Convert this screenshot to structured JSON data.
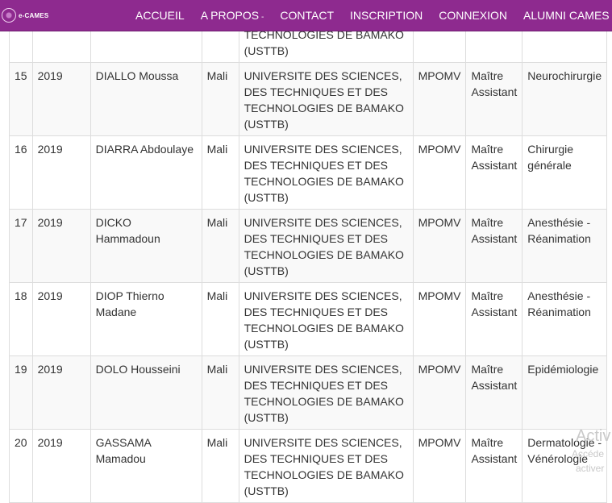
{
  "brand": {
    "logo_text": "e-CAMES"
  },
  "nav": {
    "items": [
      {
        "label": "ACCUEIL"
      },
      {
        "label": "A PROPOS",
        "caret": "-"
      },
      {
        "label": "CONTACT"
      },
      {
        "label": "INSCRIPTION"
      },
      {
        "label": "CONNEXION"
      },
      {
        "label": "ALUMNI CAMES"
      }
    ]
  },
  "table": {
    "partial_row": {
      "university": "TECHNOLOGIES DE BAMAKO\n(USTTB)"
    },
    "rows": [
      {
        "num": "15",
        "year": "2019",
        "name": "DIALLO Moussa",
        "country": "Mali",
        "university": "UNIVERSITE DES SCIENCES,\nDES TECHNIQUES ET DES\nTECHNOLOGIES DE BAMAKO\n(USTTB)",
        "ctc": "MPOMV",
        "grade": "Maître\nAssistant",
        "specialty": "Neurochirurgie"
      },
      {
        "num": "16",
        "year": "2019",
        "name": "DIARRA Abdoulaye",
        "country": "Mali",
        "university": "UNIVERSITE DES SCIENCES,\nDES TECHNIQUES ET DES\nTECHNOLOGIES DE BAMAKO\n(USTTB)",
        "ctc": "MPOMV",
        "grade": "Maître\nAssistant",
        "specialty": "Chirurgie\ngénérale"
      },
      {
        "num": "17",
        "year": "2019",
        "name": "DICKO\nHammadoun",
        "country": "Mali",
        "university": "UNIVERSITE DES SCIENCES,\nDES TECHNIQUES ET DES\nTECHNOLOGIES DE BAMAKO\n(USTTB)",
        "ctc": "MPOMV",
        "grade": "Maître\nAssistant",
        "specialty": "Anesthésie -\nRéanimation"
      },
      {
        "num": "18",
        "year": "2019",
        "name": "DIOP Thierno\nMadane",
        "country": "Mali",
        "university": "UNIVERSITE DES SCIENCES,\nDES TECHNIQUES ET DES\nTECHNOLOGIES DE BAMAKO\n(USTTB)",
        "ctc": "MPOMV",
        "grade": "Maître\nAssistant",
        "specialty": "Anesthésie -\nRéanimation"
      },
      {
        "num": "19",
        "year": "2019",
        "name": "DOLO Housseini",
        "country": "Mali",
        "university": "UNIVERSITE DES SCIENCES,\nDES TECHNIQUES ET DES\nTECHNOLOGIES DE BAMAKO\n(USTTB)",
        "ctc": "MPOMV",
        "grade": "Maître\nAssistant",
        "specialty": "Epidémiologie"
      },
      {
        "num": "20",
        "year": "2019",
        "name": "GASSAMA\nMamadou",
        "country": "Mali",
        "university": "UNIVERSITE DES SCIENCES,\nDES TECHNIQUES ET DES\nTECHNOLOGIES DE BAMAKO\n(USTTB)",
        "ctc": "MPOMV",
        "grade": "Maître\nAssistant",
        "specialty": "Dermatologie -\nVénérologie"
      }
    ]
  },
  "watermark": {
    "line1": "Activ",
    "line2": "Accéde",
    "line3": "activer"
  }
}
